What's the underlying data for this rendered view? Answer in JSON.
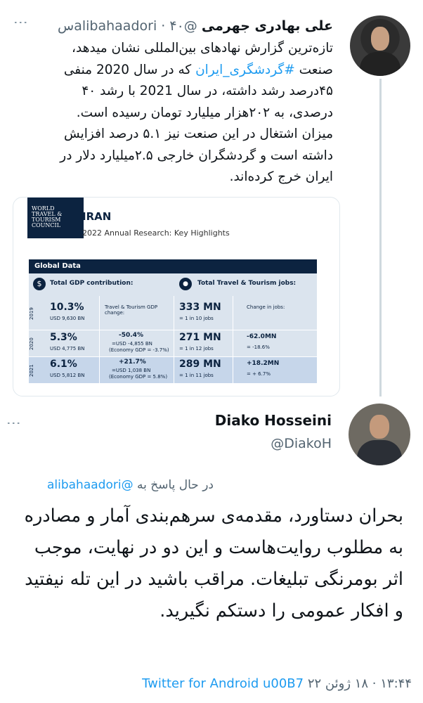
{
  "tweet1": {
    "name": "علی بهادری جهرمی",
    "handle": "@alibahaadori",
    "time": "۴۰س",
    "body_before_tag": "تازه‌ترین گزارش نهادهای بین‌المللی نشان میدهد، صنعت",
    "hashtag": "#گردشگری_ایران",
    "body_after_tag": "که در سال 2020 منفی ۴۵درصد رشد داشته، در سال 2021 با رشد ۴۰ درصدی، به ۲۰۲هزار میلیارد تومان رسیده است.",
    "body_second": "میزان اشتغال در این صنعت نیز ۵.۱ درصد افزایش داشته است و گردشگران خارجی ۲.۵میلیارد دلار در ایران خرج کرده‌اند."
  },
  "card": {
    "logo_lines": [
      "WORLD",
      "TRAVEL &",
      "TOURISM",
      "COUNCIL"
    ],
    "country": "IRAN",
    "subtitle": "2022 Annual Research: Key Highlights",
    "section_title": "Global Data",
    "gdp_label": "Total GDP contribution:",
    "jobs_label": "Total Travel & Tourism jobs:",
    "gdp_change_label": "Travel & Tourism GDP change:",
    "jobs_change_label": "Change in jobs:",
    "rows": [
      {
        "year": "2019",
        "gdp": "10.3%",
        "gdp_usd": "USD 9,630 BN",
        "gdp_change": "",
        "gdp_change_usd": "",
        "gdp_economy": "",
        "jobs": "333 MN",
        "jobs_ratio": "= 1 in 10 jobs",
        "jobs_change": "",
        "jobs_change_pct": ""
      },
      {
        "year": "2020",
        "gdp": "5.3%",
        "gdp_usd": "USD 4,775 BN",
        "gdp_change": "-50.4%",
        "gdp_change_usd": "=USD -4,855 BN",
        "gdp_economy": "(Economy GDP = -3.7%)",
        "jobs": "271 MN",
        "jobs_ratio": "= 1 in 12 jobs",
        "jobs_change": "-62.0MN",
        "jobs_change_pct": "= -18.6%"
      },
      {
        "year": "2021",
        "gdp": "6.1%",
        "gdp_usd": "USD 5,812 BN",
        "gdp_change": "+21.7%",
        "gdp_change_usd": "=USD 1,038 BN",
        "gdp_economy": "(Economy GDP = 5.8%)",
        "jobs": "289 MN",
        "jobs_ratio": "= 1 in 11 jobs",
        "jobs_change": "+18.2MN",
        "jobs_change_pct": "= + 6.7%"
      }
    ]
  },
  "tweet2": {
    "name": "Diako Hosseini",
    "handle": "@DiakoH",
    "replying_prefix": "در حال پاسخ به",
    "replying_handle": "@alibahaadori",
    "body": "بحران دستاورد، مقدمه‌ی سرهم‌بندی آمار و مصادره به مطلوب روایت‌هاست و این دو در نهایت، موجب اثر بومرنگی تبلیغات. مراقب باشید در این تله نیفتید و افکار عمومی را دستکم نگیرید.",
    "timestamp": "۱۳:۴۴ · ۱۸ ژوئن ۲۲",
    "client": "Twitter for Android u00B7"
  }
}
